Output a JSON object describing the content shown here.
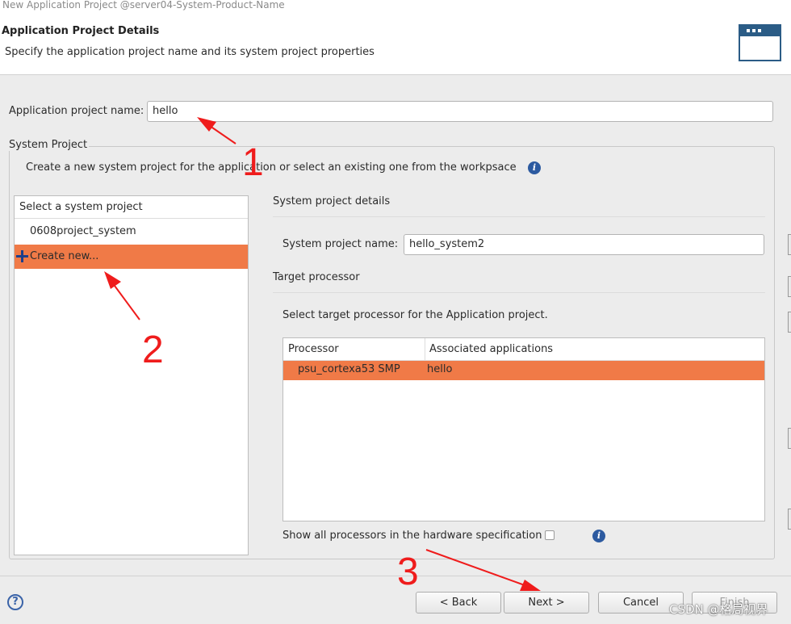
{
  "window": {
    "title": "New Application Project @server04-System-Product-Name"
  },
  "header": {
    "title": "Application Project Details",
    "subtitle": "Specify the application project name and its system project properties",
    "icon": "wizard-window-icon"
  },
  "app_name": {
    "label": "Application project name:",
    "value": "hello"
  },
  "system_project": {
    "group_label": "System Project",
    "description": "Create a new system project for the application or select an existing one from the workpsace",
    "list": {
      "header": "Select a system project",
      "items": [
        "0608project_system",
        "Create new..."
      ]
    },
    "details": {
      "heading": "System project details",
      "name_label": "System project name:",
      "name_value": "hello_system2",
      "target_heading": "Target processor",
      "target_desc": "Select target processor for the Application project.",
      "table": {
        "columns": [
          "Processor",
          "Associated applications"
        ],
        "rows": [
          [
            "psu_cortexa53 SMP",
            "hello"
          ]
        ]
      },
      "show_all_label": "Show all processors in the hardware specification",
      "show_all_checked": false
    }
  },
  "buttons": {
    "back": "< Back",
    "next": "Next >",
    "cancel": "Cancel",
    "finish": "Finish"
  },
  "annotations": {
    "n1": "1",
    "n2": "2",
    "n3": "3",
    "color": "#ef1c1c"
  },
  "watermark": "CSDN @格局视界",
  "colors": {
    "selection": "#f07a47",
    "icon_blue": "#2c5aa0",
    "wizard_icon": "#2b5c86"
  }
}
